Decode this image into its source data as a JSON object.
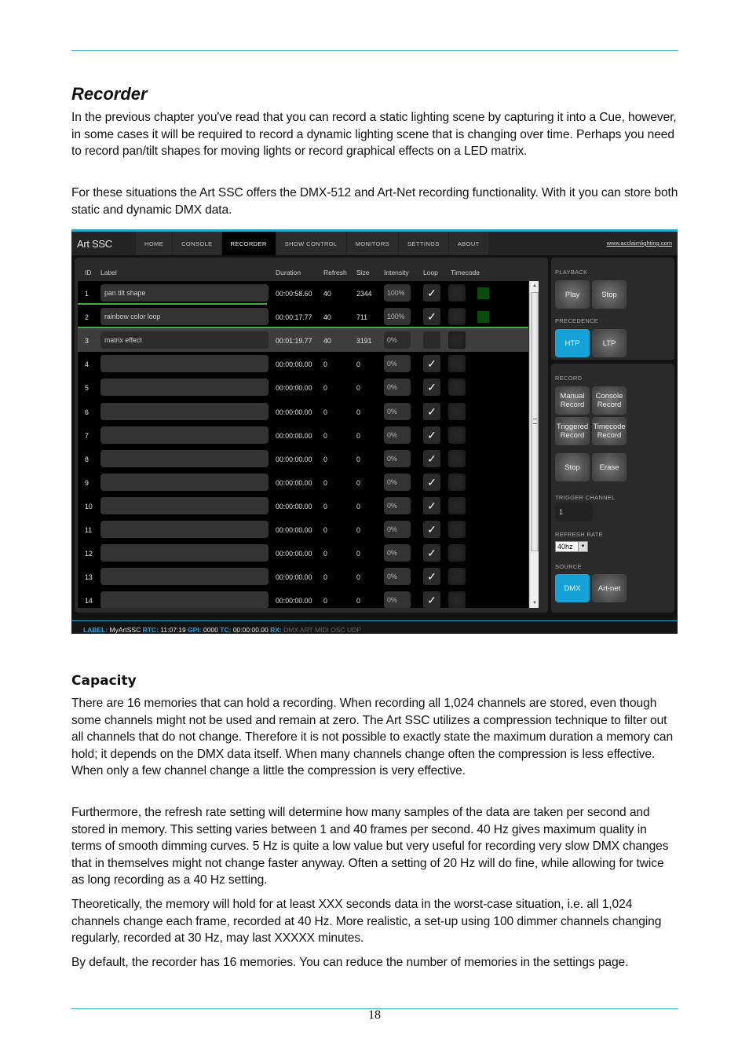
{
  "document": {
    "section_title": "Recorder",
    "intro_paragraphs": [
      "In the previous chapter you've read that you can record a static lighting scene by capturing it into a Cue, however, in some cases it will be required to record a dynamic lighting scene that is changing over time. Perhaps you need to record pan/tilt shapes for moving lights or record graphical effects on a LED matrix.",
      "For these situations the Art SSC offers the DMX-512 and Art-Net recording functionality. With it you can store both static and dynamic DMX data."
    ],
    "subsection_title": "Capacity",
    "capacity_paragraphs": [
      "There are 16 memories that can hold a recording. When recording all 1,024 channels are stored, even though some channels might not be used and remain at zero. The Art SSC utilizes a compression technique to filter out all channels that do not change. Therefore it is not possible to exactly state the maximum duration a memory can hold; it depends on the DMX data itself. When many channels change often the compression is less effective. When only a few channel change a little the compression is very effective.",
      "Furthermore, the refresh rate setting will determine how many samples of the data are taken per second and stored in memory. This setting varies between 1 and 40 frames per second. 40 Hz gives maximum quality in terms of smooth dimming curves. 5 Hz is quite a low value but very useful for recording very slow DMX changes that in themselves might not change faster anyway. Often a setting of 20 Hz will do fine, while allowing for twice as long recording as a 40 Hz setting.",
      "Theoretically, the memory will hold for at least XXX seconds data in the worst-case situation, i.e. all 1,024 channels change each frame, recorded at 40 Hz. More realistic, a set-up using 100 dimmer channels changing regularly, recorded at 30 Hz, may last XXXXX minutes.",
      "By default, the recorder has 16 memories. You can reduce the number of memories in the settings page."
    ],
    "page_number": "18"
  },
  "app": {
    "brand": "Art SSC",
    "nav_tabs": [
      {
        "label": "HOME",
        "active": false
      },
      {
        "label": "CONSOLE",
        "active": false
      },
      {
        "label": "RECORDER",
        "active": true
      },
      {
        "label": "SHOW CONTROL",
        "active": false
      },
      {
        "label": "MONITORS",
        "active": false
      },
      {
        "label": "SETTINGS",
        "active": false
      },
      {
        "label": "ABOUT",
        "active": false
      }
    ],
    "site_link": "www.acclaimlighting.com",
    "table": {
      "headers": {
        "id": "ID",
        "label": "Label",
        "duration": "Duration",
        "refresh": "Refresh",
        "size": "Size",
        "intensity": "Intensity",
        "loop": "Loop",
        "timecode": "Timecode"
      },
      "rows": [
        {
          "id": "1",
          "label": "pan tilt shape",
          "duration": "00:00:58.60",
          "refresh": "40",
          "size": "2344",
          "intensity": "100%",
          "loop": true,
          "status_on": true,
          "selected": false,
          "progress": 0.42
        },
        {
          "id": "2",
          "label": "rainbow color loop",
          "duration": "00:00:17.77",
          "refresh": "40",
          "size": "711",
          "intensity": "100%",
          "loop": true,
          "status_on": true,
          "selected": false,
          "progress": 1.0
        },
        {
          "id": "3",
          "label": "matrix effect",
          "duration": "00:01:19.77",
          "refresh": "40",
          "size": "3191",
          "intensity": "0%",
          "loop": false,
          "status_on": false,
          "selected": true,
          "progress": 0
        },
        {
          "id": "4",
          "label": "",
          "duration": "00:00:00.00",
          "refresh": "0",
          "size": "0",
          "intensity": "0%",
          "loop": true,
          "status_on": false,
          "selected": false,
          "progress": 0
        },
        {
          "id": "5",
          "label": "",
          "duration": "00:00:00.00",
          "refresh": "0",
          "size": "0",
          "intensity": "0%",
          "loop": true,
          "status_on": false,
          "selected": false,
          "progress": 0
        },
        {
          "id": "6",
          "label": "",
          "duration": "00:00:00.00",
          "refresh": "0",
          "size": "0",
          "intensity": "0%",
          "loop": true,
          "status_on": false,
          "selected": false,
          "progress": 0
        },
        {
          "id": "7",
          "label": "",
          "duration": "00:00:00.00",
          "refresh": "0",
          "size": "0",
          "intensity": "0%",
          "loop": true,
          "status_on": false,
          "selected": false,
          "progress": 0
        },
        {
          "id": "8",
          "label": "",
          "duration": "00:00:00.00",
          "refresh": "0",
          "size": "0",
          "intensity": "0%",
          "loop": true,
          "status_on": false,
          "selected": false,
          "progress": 0
        },
        {
          "id": "9",
          "label": "",
          "duration": "00:00:00.00",
          "refresh": "0",
          "size": "0",
          "intensity": "0%",
          "loop": true,
          "status_on": false,
          "selected": false,
          "progress": 0
        },
        {
          "id": "10",
          "label": "",
          "duration": "00:00:00.00",
          "refresh": "0",
          "size": "0",
          "intensity": "0%",
          "loop": true,
          "status_on": false,
          "selected": false,
          "progress": 0
        },
        {
          "id": "11",
          "label": "",
          "duration": "00:00:00.00",
          "refresh": "0",
          "size": "0",
          "intensity": "0%",
          "loop": true,
          "status_on": false,
          "selected": false,
          "progress": 0
        },
        {
          "id": "12",
          "label": "",
          "duration": "00:00:00.00",
          "refresh": "0",
          "size": "0",
          "intensity": "0%",
          "loop": true,
          "status_on": false,
          "selected": false,
          "progress": 0
        },
        {
          "id": "13",
          "label": "",
          "duration": "00:00:00.00",
          "refresh": "0",
          "size": "0",
          "intensity": "0%",
          "loop": true,
          "status_on": false,
          "selected": false,
          "progress": 0
        },
        {
          "id": "14",
          "label": "",
          "duration": "00:00:00.00",
          "refresh": "0",
          "size": "0",
          "intensity": "0%",
          "loop": true,
          "status_on": false,
          "selected": false,
          "progress": 0
        }
      ]
    },
    "side": {
      "playback_label": "PLAYBACK",
      "play": "Play",
      "stop": "Stop",
      "precedence_label": "PRECEDENCE",
      "htp": "HTP",
      "ltp": "LTP",
      "precedence_selected": "HTP",
      "record_label": "RECORD",
      "manual_record": "Manual Record",
      "console_record": "Console Record",
      "triggered_record": "Triggered Record",
      "timecode_record": "Timecode Record",
      "record_stop": "Stop",
      "erase": "Erase",
      "trigger_channel_label": "TRIGGER CHANNEL",
      "trigger_channel_value": "1",
      "refresh_rate_label": "REFRESH RATE",
      "refresh_rate_value": "40hz",
      "source_label": "SOURCE",
      "dmx": "DMX",
      "artnet": "Art-net",
      "source_selected": "DMX"
    },
    "statusbar": {
      "label_key": "LABEL:",
      "label_val": "MyArtSSC",
      "rtc_key": "RTC:",
      "rtc_val": "11:07:19",
      "gpi_key": "GPI:",
      "gpi_val": "0000",
      "tc_key": "TC:",
      "tc_val": "00:00:00.00",
      "rx_key": "RX:",
      "rx_val": "DMX ART MIDI OSC UDP"
    },
    "colors": {
      "accent": "#14a2d6",
      "progress": "#3cb043",
      "status_on": "#0a4d0a",
      "rule": "#31b0cf"
    }
  }
}
